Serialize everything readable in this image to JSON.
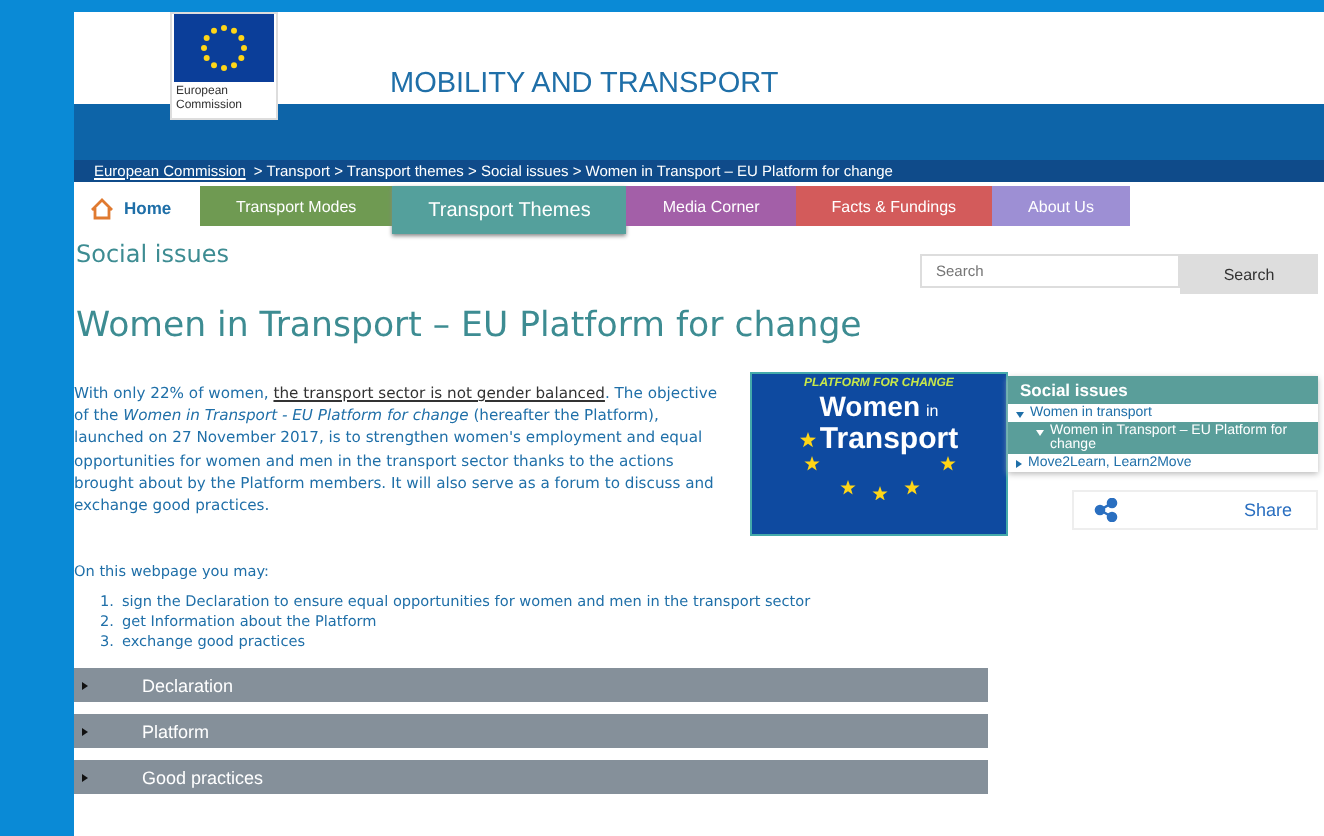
{
  "header": {
    "logo_caption": "European Commission",
    "site_title": "MOBILITY AND TRANSPORT"
  },
  "breadcrumb": [
    {
      "label": "European Commission",
      "kind": "link"
    },
    {
      "label": "> Transport > Transport themes > Social issues > Women in Transport – EU Platform for change",
      "kind": "text"
    }
  ],
  "nav": [
    {
      "label": "Home",
      "kind": "home",
      "selected": false,
      "color": "#ffffff"
    },
    {
      "label": "Transport Modes",
      "kind": "tab",
      "selected": false,
      "color": "#6f9a52"
    },
    {
      "label": "Transport Themes",
      "kind": "tab",
      "selected": true,
      "color": "#54a09c"
    },
    {
      "label": "Media Corner",
      "kind": "tab",
      "selected": false,
      "color": "#a35fa8"
    },
    {
      "label": "Facts & Fundings",
      "kind": "tab",
      "selected": false,
      "color": "#d35b5b"
    },
    {
      "label": "About Us",
      "kind": "tab",
      "selected": false,
      "color": "#9d8fd4"
    }
  ],
  "section_title": "Social issues",
  "search": {
    "placeholder": "Search",
    "button": "Search"
  },
  "page_title": "Women in Transport – EU Platform for change",
  "intro": [
    {
      "kind": "text",
      "text": "With only 22% of women, "
    },
    {
      "kind": "link",
      "text": "the transport sector is not gender balanced"
    },
    {
      "kind": "text",
      "text": ". The objective of the *Women in Transport - EU Platform for change* (hereafter the Platform), launched on 27 November 2017, is to strengthen women's employment and equal opportunities for women and men in the transport sector thanks to the actions brought about by the Platform members. It will also serve as a forum to discuss and exchange good practices."
    }
  ],
  "banner": {
    "arc_text": "PLATFORM FOR CHANGE",
    "line_1": "Women",
    "line_1_small": "in",
    "line_2": "Transport"
  },
  "sidebar": {
    "title": "Social issues",
    "items": [
      {
        "label": "Women in transport",
        "expanded": true,
        "selected": false,
        "children": [
          {
            "label": "Women in Transport – EU Platform for change",
            "expanded": true,
            "selected": true
          }
        ]
      },
      {
        "label": "Move2Learn, Learn2Move",
        "expanded": false,
        "selected": false
      }
    ]
  },
  "share": "Share",
  "list_intro": "On this webpage you may:",
  "list": [
    {
      "number": "1.",
      "text": "sign the Declaration to ensure equal opportunities for women and men in the transport sector"
    },
    {
      "number": "2.",
      "text": "get Information about the Platform"
    },
    {
      "number": "3.",
      "text": "exchange good practices"
    }
  ],
  "accordion": [
    {
      "label": "Declaration",
      "expanded": false
    },
    {
      "label": "Platform",
      "expanded": false
    },
    {
      "label": "Good practices",
      "expanded": false
    }
  ]
}
